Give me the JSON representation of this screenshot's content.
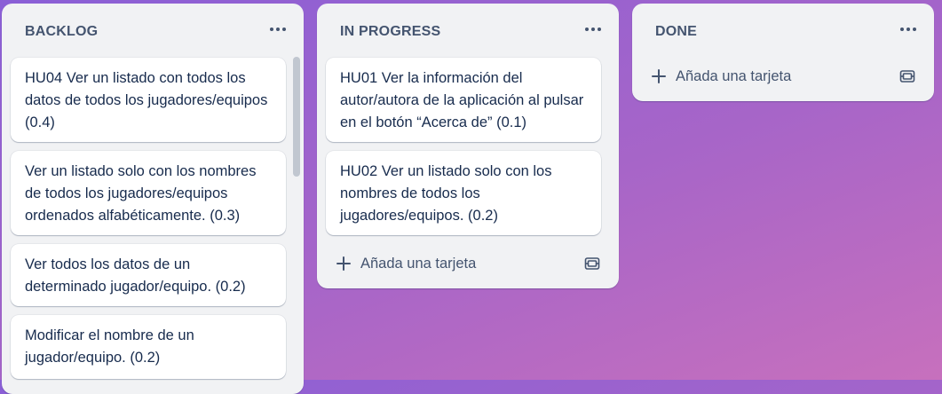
{
  "board": {
    "background_colors": [
      "#8a5fd6",
      "#c770bd"
    ],
    "lists": [
      {
        "title": "BACKLOG",
        "cards": [
          "HU04 Ver un listado con todos los datos de todos los jugadores/equipos (0.4)",
          "Ver un listado solo con los nombres de todos los jugadores/equipos ordenados alfabéticamente. (0.3)",
          "Ver todos los datos de un determinado jugador/equipo. (0.2)",
          "Modificar el nombre de un jugador/equipo. (0.2)"
        ]
      },
      {
        "title": "IN PROGRESS",
        "cards": [
          "HU01 Ver la información del autor/autora de la aplicación al pulsar en el botón “Acerca de” (0.1)",
          "HU02 Ver un listado solo con los nombres de todos los jugadores/equipos. (0.2)"
        ],
        "add_card_label": "Añada una tarjeta"
      },
      {
        "title": "DONE",
        "cards": [],
        "add_card_label": "Añada una tarjeta"
      }
    ]
  },
  "icons": {
    "list_menu": "more-horizontal-icon",
    "add": "plus-icon",
    "template": "card-template-icon"
  }
}
